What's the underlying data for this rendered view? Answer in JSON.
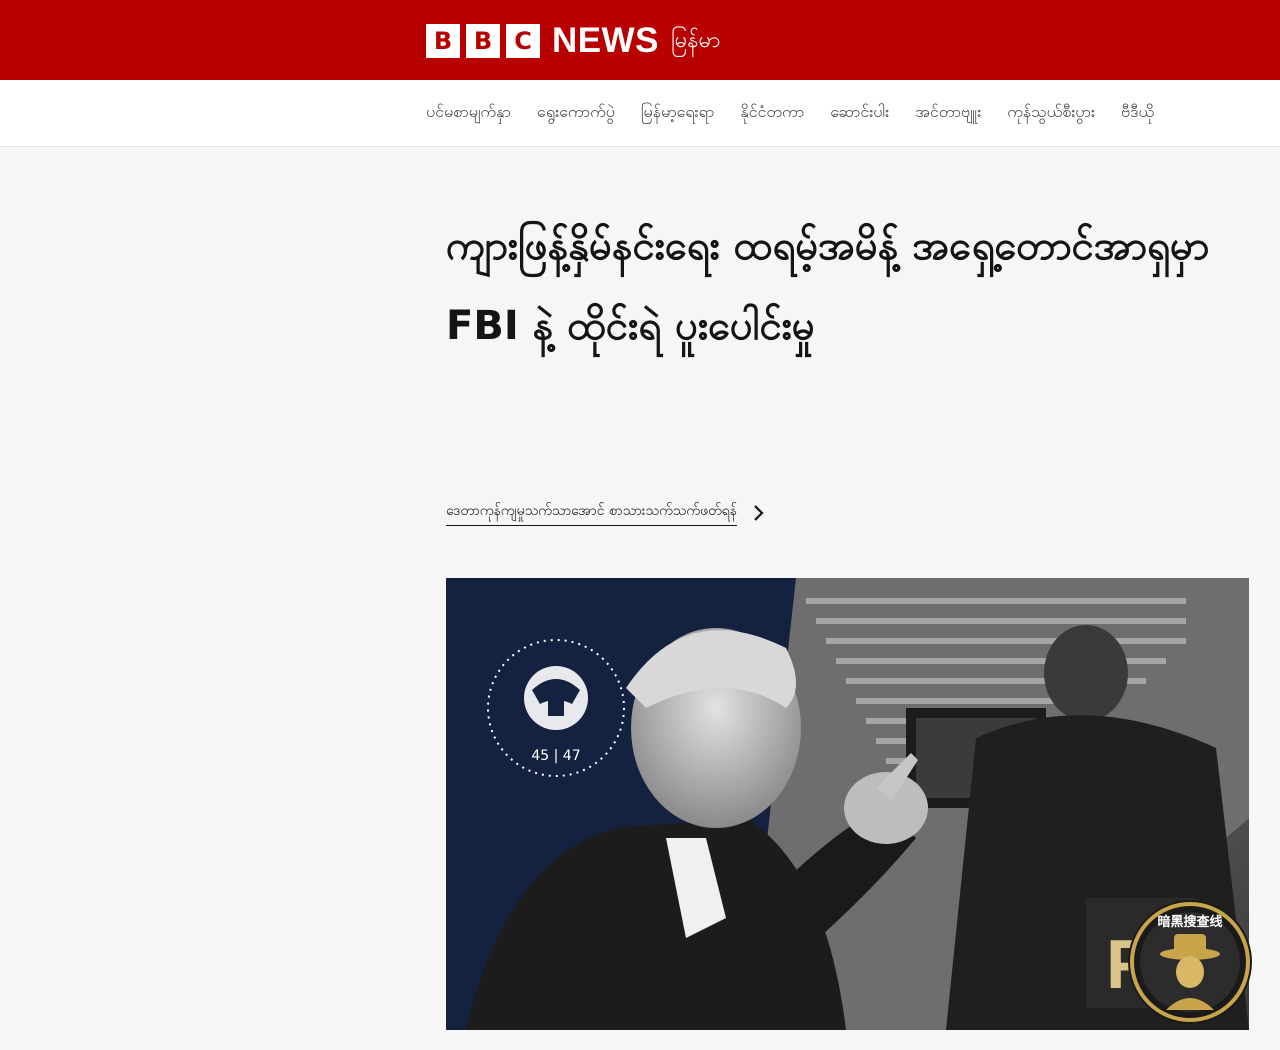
{
  "masthead": {
    "bbc_letters": [
      "B",
      "B",
      "C"
    ],
    "news_label": "NEWS",
    "service_name": "မြန်မာ",
    "brand_color": "#b80000"
  },
  "nav": {
    "items": [
      "ပင်မစာမျက်နှာ",
      "ရွေးကောက်ပွဲ",
      "မြန်မာ့ရေးရာ",
      "နိုင်ငံတကာ",
      "ဆောင်းပါး",
      "အင်တာဗျူး",
      "ကုန်သွယ်စီးပွား",
      "ဗီဒီယို"
    ]
  },
  "article": {
    "headline": "ကျားဖြန့်နှိမ်နင်းရေး ထရမ့်အမိန့် အရှေ့တောင်အာရှမှာ FBI နဲ့ ထိုင်းရဲ ပူးပေါင်းမှု",
    "byline": "ဒေတာကုန်ကျမှုသက်သာအောင် စာသားသက်သက်ဖတ်ရန်",
    "byline_icon": "chevron-right-icon"
  },
  "hero": {
    "seal_numbers": "45 | 47",
    "jacket_letters": "FBI"
  },
  "watermark": {
    "text": "暗黑搜查线"
  }
}
